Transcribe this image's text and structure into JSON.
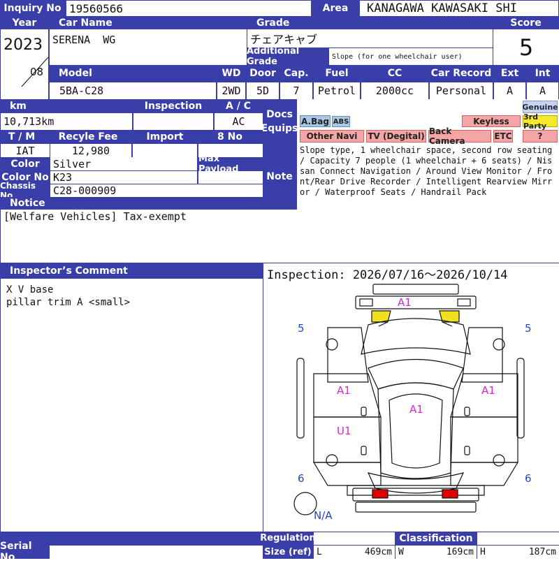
{
  "inquiry": {
    "label": "Inquiry No",
    "value": "19560566"
  },
  "area": {
    "label": "Area",
    "value": "KANAGAWA KAWASAKI SHI"
  },
  "year": {
    "label": "Year",
    "value": "2023",
    "month": "08"
  },
  "car_name": {
    "label": "Car Name",
    "value": "SERENA  WG"
  },
  "grade": {
    "label": "Grade",
    "value": "チェアキャブ",
    "additional_label": "Additional Grade",
    "additional_value": "Slope (for one wheelchair user)"
  },
  "score": {
    "label": "Score",
    "value": "5"
  },
  "model": {
    "label": "Model",
    "value": "5BA-C28"
  },
  "wd": {
    "label": "WD",
    "value": "2WD"
  },
  "door": {
    "label": "Door",
    "value": "5D"
  },
  "cap": {
    "label": "Cap.",
    "value": "7"
  },
  "fuel": {
    "label": "Fuel",
    "value": "Petrol"
  },
  "cc": {
    "label": "CC",
    "value": "2000cc"
  },
  "car_record": {
    "label": "Car Record",
    "value": "Personal"
  },
  "ext": {
    "label": "Ext",
    "value": "A"
  },
  "int": {
    "label": "Int",
    "value": "A"
  },
  "km": {
    "label": "km",
    "value": "10,713km"
  },
  "inspection_field": {
    "label": "Inspection",
    "value": ""
  },
  "ac": {
    "label": "A / C",
    "value": "AC"
  },
  "docs": {
    "label_line1": "Docs",
    "label_line2": "Equips"
  },
  "equipment": {
    "abag": "A.Bag",
    "abs": "ABS",
    "keyless": "Keyless",
    "genuine": "Genuine",
    "third_party": "3rd Party",
    "other_navi": "Other Navi",
    "tv": "TV (Degital)",
    "back_camera": "Back Camera",
    "etc": "ETC",
    "unknown": "?"
  },
  "tm": {
    "label": "T / M",
    "value": "IAT"
  },
  "recycle": {
    "label": "Recyle Fee",
    "value": "12,980"
  },
  "import": {
    "label": "Import",
    "value": ""
  },
  "eight_no": {
    "label": "8 No",
    "value": ""
  },
  "color": {
    "label": "Color",
    "value": "Silver"
  },
  "max_payload": {
    "label": "Max Payload",
    "value": ""
  },
  "color_no": {
    "label": "Color No",
    "value": "K23"
  },
  "chassis": {
    "label": "Chassis No",
    "value": "C28-000909"
  },
  "note": {
    "label": "Note",
    "value": "Slope type, 1 wheelchair space, second row seating / Capacity 7 people (1 wheelchair + 6 seats) / Nissan Connect Navigation / Around View Monitor / Front/Rear Drive Recorder / Intelligent Rearview Mirror / Waterproof Seats / Handrail Pack"
  },
  "notice": {
    "label": "Notice",
    "value": "[Welfare Vehicles] Tax-exempt"
  },
  "inspector": {
    "label": "Inspector’s Comment",
    "line1": "X V base",
    "line2": "pillar trim A <small>"
  },
  "inspection_period": "Inspection: 2026/07/16〜2026/10/14",
  "diagram": {
    "front_bumper": "A1",
    "left_front_door": "A1",
    "right_front_door": "A1",
    "roof": "A1",
    "left_rear_door": "U1",
    "front_left_tire": "5",
    "front_right_tire": "5",
    "rear_left_tire": "6",
    "rear_right_tire": "6",
    "spare_tire": "N/A"
  },
  "regulation": {
    "label1": "Regulation",
    "label2": "Size (ref)"
  },
  "classification": {
    "label": "Classification"
  },
  "size": {
    "l_label": "L",
    "l": "469cm",
    "w_label": "W",
    "w": "169cm",
    "h_label": "H",
    "h": "187cm"
  },
  "serial": {
    "label": "Serial No"
  },
  "colors": {
    "header": "#3a3ea8",
    "damage": "#d629c8",
    "tire": "#2244cc",
    "light": "#f0e020",
    "tail": "#e00000"
  }
}
